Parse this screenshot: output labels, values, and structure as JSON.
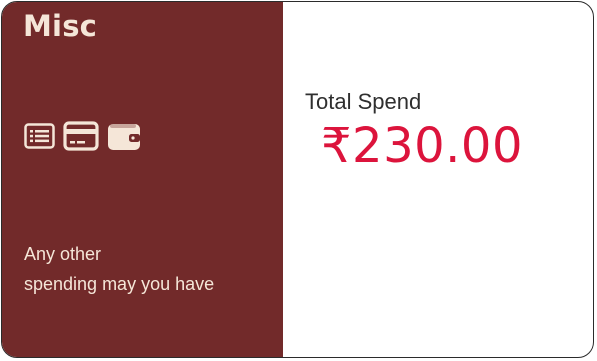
{
  "category": {
    "title": "Misc",
    "description_line1": "Any other",
    "description_line2": "spending may you have",
    "icons": [
      "list-icon",
      "credit-card-icon",
      "wallet-icon"
    ]
  },
  "summary": {
    "label": "Total Spend",
    "amount": "₹230.00"
  },
  "colors": {
    "panel": "#722a2a",
    "panel_text": "#f5e6d8",
    "amount": "#dc143c",
    "label": "#2f2f2f"
  }
}
